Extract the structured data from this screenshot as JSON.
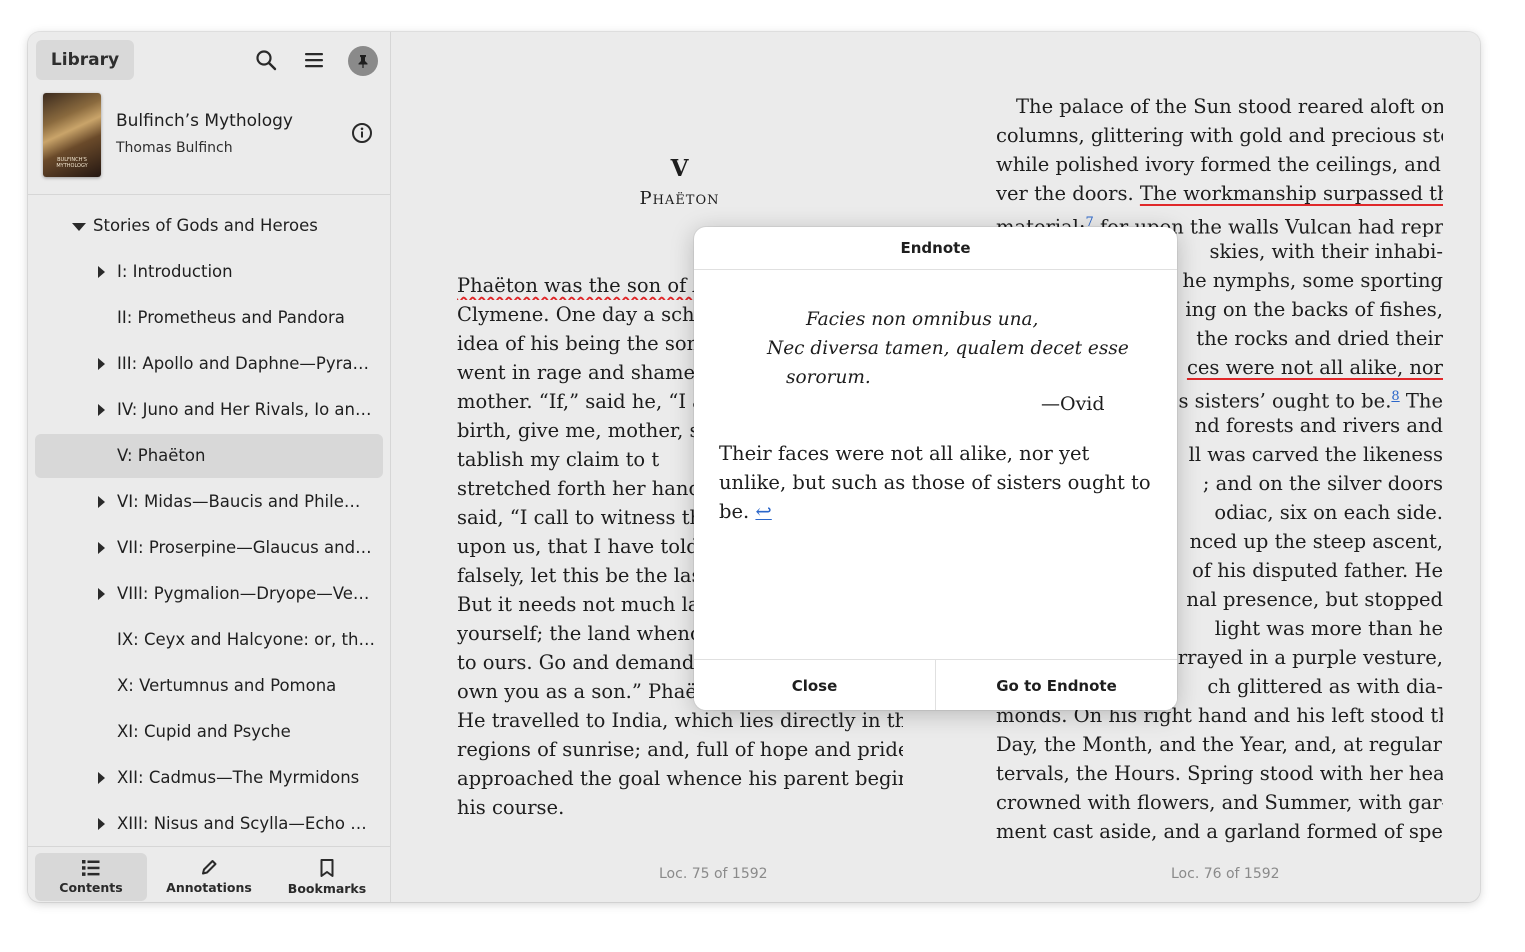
{
  "header": {
    "library_label": "Library"
  },
  "book": {
    "title": "Bulfinch’s Mythology",
    "author": "Thomas Bulfinch",
    "cover_text": "BULFINCH'S MYTHOLOGY"
  },
  "toc": [
    {
      "label": "Stories of Gods and Heroes",
      "expander": "expanded",
      "selected": false
    },
    {
      "label": "I: Introduction",
      "expander": "collapsed",
      "selected": false
    },
    {
      "label": "II: Prometheus and Pandora",
      "expander": "none",
      "selected": false
    },
    {
      "label": "III: Apollo and Daphne—Pyra…",
      "expander": "collapsed",
      "selected": false
    },
    {
      "label": "IV: Juno and Her Rivals, Io and …",
      "expander": "collapsed",
      "selected": false
    },
    {
      "label": "V: Phaëton",
      "expander": "none",
      "selected": true
    },
    {
      "label": "VI: Midas—Baucis and Philemon",
      "expander": "collapsed",
      "selected": false
    },
    {
      "label": "VII: Proserpine—Glaucus and …",
      "expander": "collapsed",
      "selected": false
    },
    {
      "label": "VIII: Pygmalion—Dryope—Ve…",
      "expander": "collapsed",
      "selected": false
    },
    {
      "label": "IX: Ceyx and Halcyone: or, the …",
      "expander": "none",
      "selected": false
    },
    {
      "label": "X: Vertumnus and Pomona",
      "expander": "none",
      "selected": false
    },
    {
      "label": "XI: Cupid and Psyche",
      "expander": "none",
      "selected": false
    },
    {
      "label": "XII: Cadmus—The Myrmidons",
      "expander": "collapsed",
      "selected": false
    },
    {
      "label": "XIII: Nisus and Scylla—Echo a…",
      "expander": "collapsed",
      "selected": false
    }
  ],
  "footer_tabs": [
    {
      "label": "Contents",
      "icon": "list-icon",
      "selected": true
    },
    {
      "label": "Annotations",
      "icon": "pencil-icon",
      "selected": false
    },
    {
      "label": "Bookmarks",
      "icon": "bookmark-icon",
      "selected": false
    }
  ],
  "left_page": {
    "chapter_number": "V",
    "chapter_title": "Phaëton",
    "lines": [
      "Phaëton was the son of A",
      "Clymene. One day a scho",
      "idea of his being the son o",
      "went in rage and shame",
      "mother. “If,” said he, “I a",
      "birth, give me, mother, so",
      "tablish my claim to t",
      "stretched forth her hands",
      "said, “I call to witness the",
      "upon us, that I have told y",
      "falsely, let this be the last",
      "But it needs not much labo",
      "yourself; the land whence",
      "to ours. Go and demand o",
      "own you as a son.” Phaëto",
      "He travelled to India, which lies directly in the",
      "regions of sunrise; and, full of hope and pride,",
      "approached the goal whence his parent begins",
      "his course."
    ],
    "location": "Loc. 75 of 1592"
  },
  "right_page": {
    "lines": [
      "The palace of the Sun stood reared aloft on",
      "columns, glittering with gold and precious stones,",
      "while polished ivory formed the ceilings, and sil-",
      "ver the doors. ",
      "The workmanship surpassed the",
      "material;",
      "7",
      " for upon the walls Vulcan had repre-",
      "skies, with their inhabi-",
      "he nymphs, some sporting",
      "ing on the backs of fishes,",
      "the rocks and dried their",
      "ces were not all alike, nor",
      "s sisters’ ought to be.",
      "8",
      " The",
      "nd forests and rivers and",
      "ll was carved the likeness",
      "; and on the silver doors",
      "odiac, six on each side.",
      "nced up the steep ascent,",
      "of his disputed father. He",
      "nal presence, but stopped",
      "light was more than he",
      "rrayed in a purple vesture,",
      "ch glittered as with dia-",
      "monds. On his right hand and his left stood the",
      "Day, the Month, and the Year, and, at regular in-",
      "tervals, the Hours. Spring stood with her head",
      "crowned with flowers, and Summer, with gar-",
      "ment cast aside, and a garland formed of spears"
    ],
    "location": "Loc. 76 of 1592"
  },
  "dialog": {
    "title": "Endnote",
    "verse_1": "Facies non omnibus una,",
    "verse_2": "Nec diversa tamen, qualem decet esse",
    "verse_3": "sororum.",
    "attribution": "—Ovid",
    "translation": "Their faces were not all alike, nor yet unlike, but such as those of sisters ought to be.",
    "backlink": "↩",
    "close_label": "Close",
    "goto_label": "Go to Endnote"
  },
  "colors": {
    "accent_link": "#2b66c9",
    "spell_underline": "#e0282a",
    "selected_row": "#d8d8d8"
  }
}
